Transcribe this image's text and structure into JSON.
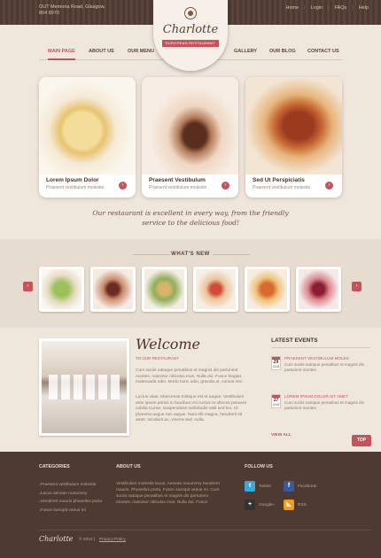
{
  "topbar": {
    "address_line": "OUT Memoria Road, Glasgow,",
    "phone_line": "804 8970",
    "links": [
      "Home",
      "Login",
      "FAQs",
      "Help"
    ]
  },
  "logo": {
    "name": "Charlotte",
    "tagline": "EUROPEAN RESTAURANT"
  },
  "nav": {
    "items": [
      "MAIN PAGE",
      "ABOUT US",
      "OUR MENU",
      "GALLERY",
      "OUR BLOG",
      "CONTACT US"
    ],
    "active": 0
  },
  "features": [
    {
      "title": "Lorem Ipsum Dolor",
      "subtitle": "Praesent vestibulum molestie",
      "image": "pasta-dish"
    },
    {
      "title": "Praesent Vestibulum",
      "subtitle": "Praesent vestibulum molestie",
      "image": "tiramisu-cake"
    },
    {
      "title": "Sed Ut Perspiciatis",
      "subtitle": "Praesent vestibulum molestie",
      "image": "roasted-chicken"
    }
  ],
  "quote": "Our restaurant is excellent in every way, from the friendly service to the delicious food!",
  "whats_new": {
    "title": "WHAT'S NEW",
    "prev_label": "‹",
    "next_label": "›",
    "items": [
      "salad",
      "cupcake",
      "vegetable-salad",
      "tomato-plate",
      "pizza",
      "berry-cake"
    ]
  },
  "welcome": {
    "heading": "Welcome",
    "subheading": "TO OUR RESTAURANT",
    "paragraph1": "Cum sociis natoque penatibus et magnis dis parturient montes, nascetur ridiculus mus. Nulla dui. Fusce feugiat malesuada odio. Morbi nunc odio, gravida at, cursus nec.",
    "paragraph2": "Luctus vitae, Maecenas tristique est et augue. Vestibulum ante ipsum primis in faucibus orci luctus et ultrices posuere cubilia Curae; Suspendisse sollicitudin velit sed leo. Ut pharetra augue nec augue. Nam elit magna, hendrerit sit amet, tincidunt ac, viverra sed, nulla."
  },
  "events": {
    "title": "LATEST EVENTS",
    "items": [
      {
        "day": "29",
        "month": "JUNE",
        "name": "PRAESENT VESTIBULUM MOLES",
        "text": "Cum sociis natoque penatibus et magnis dis parturient montes"
      },
      {
        "day": "27",
        "month": "JUNE",
        "name": "LOREM IPSUM DOLOR SIT AMET",
        "text": "Cum sociis natoque penatibus et magnis dis parturient montes"
      }
    ],
    "view_all": "VIEW ALL",
    "top_label": "TOP"
  },
  "footer": {
    "categories_title": "CATEGORIES",
    "categories": [
      "Praesent vestibulum molestie",
      "Lacus aenean nonummy",
      "Hendrerit mauris phasellus porta",
      "Fusce suscipit varius mi"
    ],
    "about_title": "ABOUT US",
    "about_text": "Vestibulum molestie lacus. Aenean nonummy hendrerit mauris. Phasellus porta. Fusce suscipit varius mi. Cum sociis natoque penatibus et magnis dis parturient montes, nascetur ridiculus mus. Nulla dui. Fusce",
    "follow_title": "FOLLOW US",
    "social": [
      {
        "name": "Twitter",
        "icon": "twitter-icon",
        "color": "#3ba8d8"
      },
      {
        "name": "Facebook",
        "icon": "facebook-icon",
        "color": "#3b5998"
      },
      {
        "name": "Google+",
        "icon": "googleplus-icon",
        "color": "#333333"
      },
      {
        "name": "RSS",
        "icon": "rss-icon",
        "color": "#f39c1f"
      }
    ],
    "logo": "Charlotte",
    "copyright": "© 2012  |",
    "privacy": "Privacy Policy"
  },
  "colors": {
    "accent": "#c7525a",
    "dark_brown": "#4f3a31",
    "background": "#efe6dc"
  }
}
